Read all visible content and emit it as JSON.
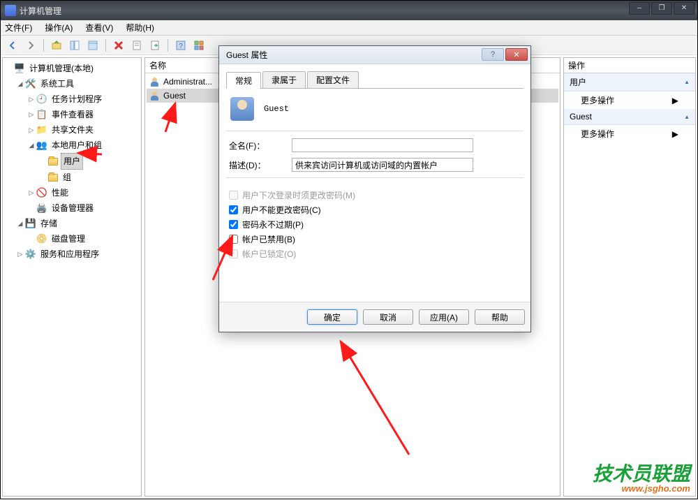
{
  "window": {
    "title": "计算机管理"
  },
  "menubar": {
    "file": "文件(F)",
    "action": "操作(A)",
    "view": "查看(V)",
    "help": "帮助(H)"
  },
  "tree": {
    "root": "计算机管理(本地)",
    "system_tools": "系统工具",
    "task_scheduler": "任务计划程序",
    "event_viewer": "事件查看器",
    "shared_folders": "共享文件夹",
    "local_users_groups": "本地用户和组",
    "users": "用户",
    "groups": "组",
    "performance": "性能",
    "device_manager": "设备管理器",
    "storage": "存储",
    "disk_management": "磁盘管理",
    "services_apps": "服务和应用程序"
  },
  "list": {
    "header": "名称",
    "items": [
      {
        "label": "Administrat..."
      },
      {
        "label": "Guest"
      }
    ]
  },
  "actions": {
    "header": "操作",
    "group1_title": "用户",
    "group1_item": "更多操作",
    "group2_title": "Guest",
    "group2_item": "更多操作"
  },
  "dialog": {
    "title": "Guest 属性",
    "tabs": {
      "general": "常规",
      "member_of": "隶属于",
      "profile": "配置文件"
    },
    "account_name": "Guest",
    "full_name_label": "全名(F)：",
    "full_name_value": "",
    "description_label": "描述(D)：",
    "description_value": "供来宾访问计算机或访问域的内置帐户",
    "checks": {
      "must_change_pw": "用户下次登录时须更改密码(M)",
      "cannot_change_pw": "用户不能更改密码(C)",
      "pw_never_expires": "密码永不过期(P)",
      "account_disabled": "帐户已禁用(B)",
      "account_locked": "帐户已锁定(O)"
    },
    "buttons": {
      "ok": "确定",
      "cancel": "取消",
      "apply": "应用(A)",
      "help": "帮助"
    }
  },
  "watermark": {
    "line1": "技术员联盟",
    "line2": "www.jsgho.com"
  }
}
